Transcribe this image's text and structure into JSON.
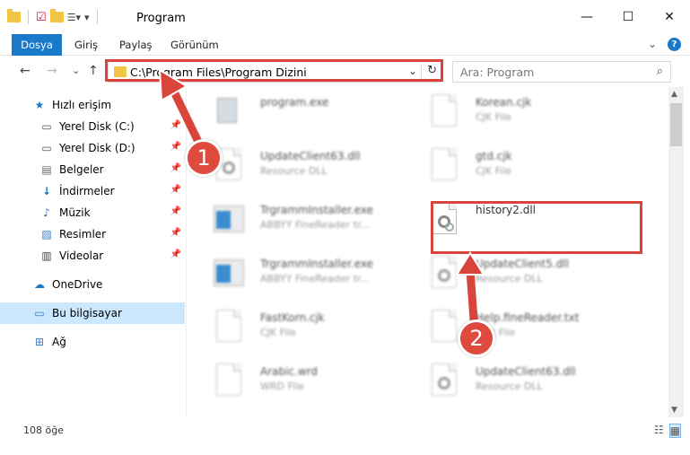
{
  "window": {
    "title": "Program",
    "minimize": "—",
    "maximize": "☐",
    "close": "✕"
  },
  "ribbon": {
    "tabs": [
      "Dosya",
      "Giriş",
      "Paylaş",
      "Görünüm"
    ],
    "expand": "⌄",
    "help": "?"
  },
  "nav": {
    "back": "←",
    "forward": "→",
    "recent": "⌄",
    "up": "↑",
    "address": "C:\\Program Files\\Program Dizini",
    "address_dropdown": "⌄",
    "refresh": "↻",
    "search_placeholder": "Ara: Program",
    "search_icon": "⌕"
  },
  "sidebar": {
    "items": [
      {
        "label": "Hızlı erişim",
        "icon": "star-icon"
      },
      {
        "label": "Yerel Disk (C:)",
        "icon": "drive-icon",
        "pinned": true
      },
      {
        "label": "Yerel Disk (D:)",
        "icon": "drive-icon",
        "pinned": true
      },
      {
        "label": "Belgeler",
        "icon": "documents-icon",
        "pinned": true
      },
      {
        "label": "İndirmeler",
        "icon": "downloads-icon",
        "pinned": true
      },
      {
        "label": "Müzik",
        "icon": "music-icon",
        "pinned": true
      },
      {
        "label": "Resimler",
        "icon": "pictures-icon",
        "pinned": true
      },
      {
        "label": "Videolar",
        "icon": "videos-icon",
        "pinned": true
      },
      {
        "label": "OneDrive",
        "icon": "cloud-icon"
      },
      {
        "label": "Bu bilgisayar",
        "icon": "computer-icon"
      },
      {
        "label": "Ağ",
        "icon": "network-icon"
      }
    ]
  },
  "files": [
    {
      "name": "program.exe",
      "type": ""
    },
    {
      "name": "Korean.cjk",
      "type": "CJK File"
    },
    {
      "name": "UpdateClient63.dll",
      "type": "Resource DLL"
    },
    {
      "name": "gtd.cjk",
      "type": "CJK File"
    },
    {
      "name": "TrgrammInstaller.exe",
      "type": "ABBYY FineReader tr..."
    },
    {
      "name": "history2.dll",
      "type": ""
    },
    {
      "name": "TrgrammInstaller.exe",
      "type": "ABBYY FineReader tr..."
    },
    {
      "name": "UpdateClient5.dll",
      "type": "Resource DLL"
    },
    {
      "name": "FastKorn.cjk",
      "type": "CJK File"
    },
    {
      "name": "Help.fineReader.txt",
      "type": "Text File"
    },
    {
      "name": "Arabic.wrd",
      "type": "WRD File"
    },
    {
      "name": "UpdateClient63.dll",
      "type": "Resource DLL"
    }
  ],
  "annotations": {
    "badge1": "1",
    "badge2": "2"
  },
  "status": {
    "count": "108 öğe"
  },
  "colors": {
    "accent": "#1979ca",
    "highlight": "#d9453b"
  }
}
